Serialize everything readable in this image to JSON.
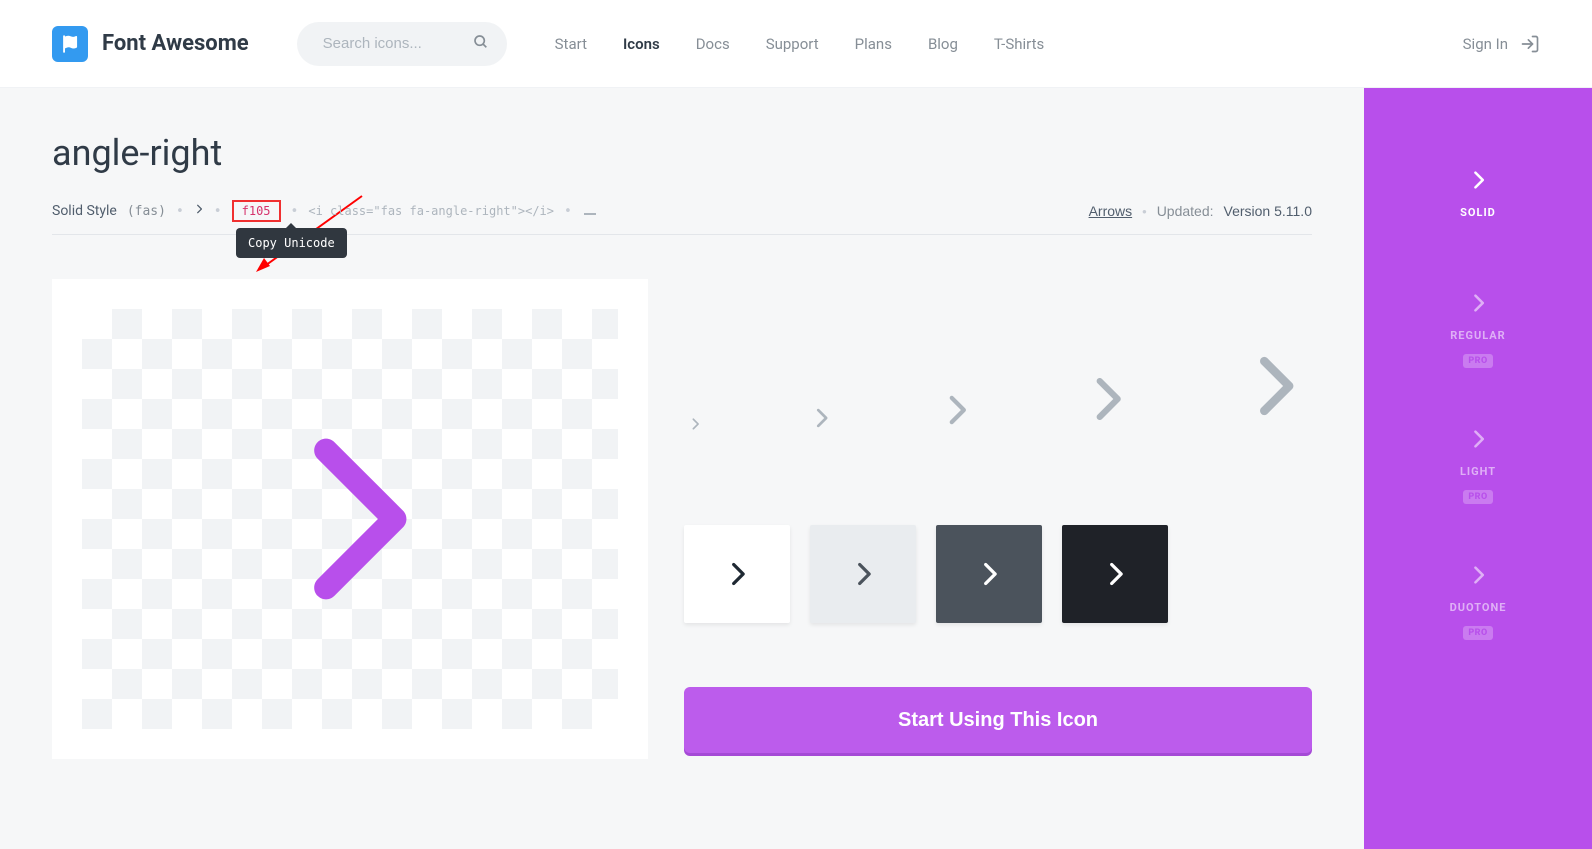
{
  "brand": {
    "name": "Font Awesome"
  },
  "search": {
    "placeholder": "Search icons..."
  },
  "nav": [
    "Start",
    "Icons",
    "Docs",
    "Support",
    "Plans",
    "Blog",
    "T-Shirts"
  ],
  "nav_active": "Icons",
  "signin": "Sign In",
  "icon": {
    "name": "angle-right",
    "style_label": "Solid Style",
    "style_prefix": "(fas)",
    "unicode": "f105",
    "tag_snippet": "<i class=\"fas fa-angle-right\"></i>",
    "category": "Arrows",
    "updated_label": "Updated:",
    "updated_value": "Version 5.11.0"
  },
  "tooltip": "Copy Unicode",
  "cta": "Start Using This Icon",
  "styles": [
    {
      "key": "solid",
      "label": "SOLID",
      "pro": false,
      "active": true
    },
    {
      "key": "regular",
      "label": "REGULAR",
      "pro": true,
      "active": false
    },
    {
      "key": "light",
      "label": "LIGHT",
      "pro": true,
      "active": false
    },
    {
      "key": "duotone",
      "label": "DUOTONE",
      "pro": true,
      "active": false
    }
  ],
  "pro_badge": "PRO"
}
